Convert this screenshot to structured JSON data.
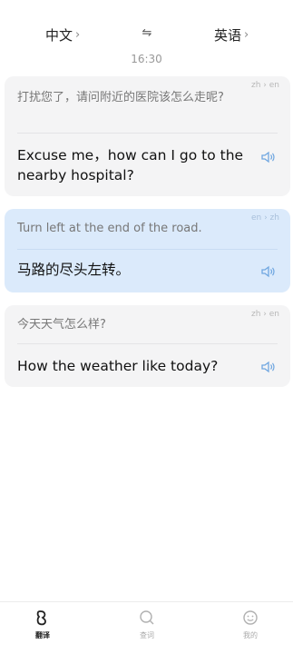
{
  "header": {
    "source_lang": "中文",
    "target_lang": "英语",
    "chevron": "›",
    "swap_glyph": "⇋",
    "time": "16:30"
  },
  "cards": [
    {
      "pair": "zh › en",
      "source": "打扰您了，请问附近的医院该怎么走呢?",
      "target": "Excuse me，how can I go to the nearby hospital?",
      "highlighted": false
    },
    {
      "pair": "en › zh",
      "source": "Turn left at the end of the road.",
      "target": "马路的尽头左转。",
      "highlighted": true
    },
    {
      "pair": "zh › en",
      "source": "今天天气怎么样?",
      "target": "How the weather like today?",
      "highlighted": false
    }
  ],
  "tabbar": {
    "tabs": [
      {
        "label": "翻译",
        "icon": "translate-icon",
        "active": true
      },
      {
        "label": "查词",
        "icon": "search-icon",
        "active": false
      },
      {
        "label": "我的",
        "icon": "profile-icon",
        "active": false
      }
    ]
  },
  "colors": {
    "card_bg": "#f4f4f5",
    "highlight_bg": "#dbeafb",
    "speaker": "#6fa6e0"
  }
}
